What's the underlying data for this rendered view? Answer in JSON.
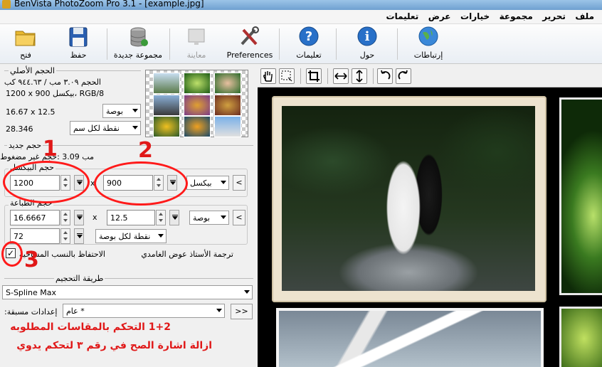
{
  "window": {
    "title": "BenVista PhotoZoom Pro 3.1 - [example.jpg]"
  },
  "menu": [
    "ملف",
    "تحرير",
    "مجموعة",
    "خيارات",
    "عرض",
    "تعليمات"
  ],
  "toolbar": {
    "open": "فتح",
    "save": "حفظ",
    "new_batch": "مجموعة جديدة",
    "preview": "معاينة",
    "preferences": "Preferences",
    "help": "تعليمات",
    "about": "حول",
    "links": "إرتباطات"
  },
  "original_size": {
    "group_title": "الحجم الأصلي",
    "size_line": "الحجم ٣.٠٩ مب / ٩٤٤.٦٣ كب",
    "pixels_line": "1200 x 900 بيكسل، RGB/8",
    "print_size": "16.67 x 12.5",
    "print_unit": "بوصة",
    "resolution": "28.346",
    "resolution_unit": "نقطة لكل سم"
  },
  "new_size": {
    "group_title": "حجم جديد",
    "uncompressed": "مب 3.09 :حجم غير مضغوط",
    "pixel_section": "حجم البيكسل",
    "width": "1200",
    "height": "900",
    "pixel_unit": "بيكسل",
    "print_section": "حجم الطباعة",
    "print_width": "16.6667",
    "print_height": "12.5",
    "print_unit": "بوصة",
    "resolution": "72",
    "resolution_unit": "نقطة لكل بوصة",
    "keep_ratio_label": "الاحتفاظ بالنسب المساحية",
    "translator_credit": "ترجمة الأستاذ عوض الغامدي",
    "times": "x",
    "link_btn": "<"
  },
  "resize_method": {
    "group_title": "طريقة التحجيم",
    "method": "S-Spline Max",
    "presets_label": "إعدادات مسبقة:",
    "preset_value": "عام *",
    "more_btn": ">>"
  },
  "annotations": {
    "n1": "1",
    "n2": "2",
    "n3": "3",
    "line1": "1+2 التحكم بالمقاسات المطلوبه",
    "line2": "ازالة اشارة الصح في رقم ٣ لتحكم يدوي"
  },
  "colors": {
    "annotation": "#e01818",
    "preview_bg": "#000000",
    "photo_frame": "#ede3cf"
  }
}
